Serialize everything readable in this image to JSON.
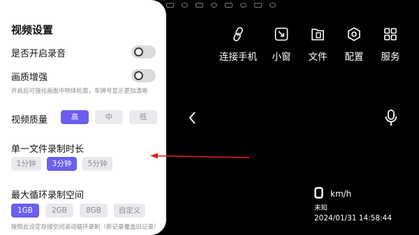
{
  "colors": {
    "accent": "#6a5ff0",
    "arrow": "#e0201b"
  },
  "status_icons": [
    "signal-icon",
    "map-icon",
    "wifi-icon",
    "sim-icon",
    "camera-icon",
    "mic-icon",
    "record-icon",
    "bluetooth-icon"
  ],
  "panel": {
    "title": "视频设置",
    "audio": {
      "label": "是否开启录音",
      "enabled": false
    },
    "enhance": {
      "label": "画质增强",
      "enabled": false,
      "hint": "开启后可强化画面中物体轮廓，车牌号显示更加清晰"
    },
    "quality": {
      "label": "视频质量",
      "options": [
        "高",
        "中",
        "低"
      ],
      "selected": "高"
    },
    "duration": {
      "label": "单一文件录制时长",
      "options": [
        "1分钟",
        "3分钟",
        "5分钟"
      ],
      "selected": "3分钟"
    },
    "space": {
      "label": "最大循环录制空间",
      "options": [
        "1GB",
        "2GB",
        "8GB",
        "自定义"
      ],
      "selected": "1GB",
      "hint": "按照此设定存储空间滚动循环录制（新记录覆盖旧记录）"
    }
  },
  "menu": [
    {
      "label": "连接手机",
      "icon": "link-icon"
    },
    {
      "label": "小窗",
      "icon": "mini-window-icon"
    },
    {
      "label": "文件",
      "icon": "file-icon"
    },
    {
      "label": "配置",
      "icon": "settings-icon"
    },
    {
      "label": "服务",
      "icon": "grid-icon"
    }
  ],
  "speed": {
    "unit": "km/h"
  },
  "location": "未知",
  "datetime": "2024/01/31 14:58:44"
}
